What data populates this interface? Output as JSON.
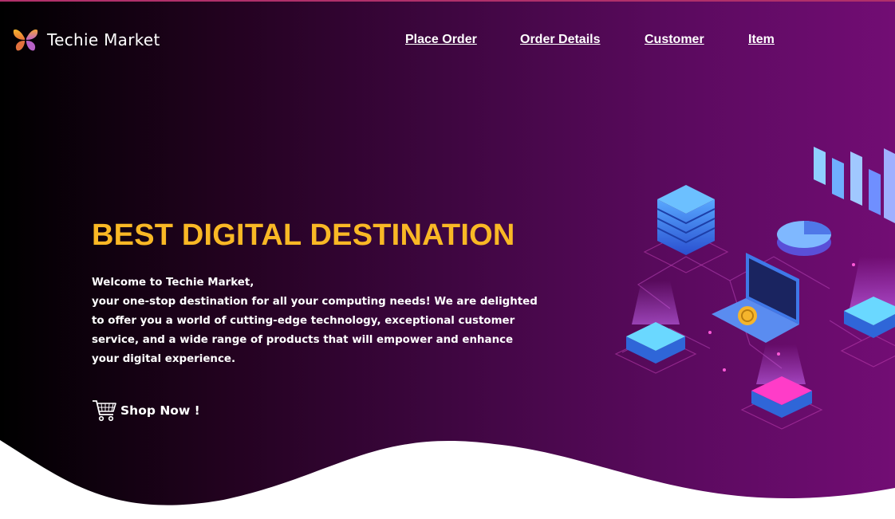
{
  "brand": {
    "name": "Techie Market"
  },
  "nav": {
    "items": [
      {
        "label": "Place Order"
      },
      {
        "label": "Order Details"
      },
      {
        "label": "Customer"
      },
      {
        "label": "Item"
      }
    ]
  },
  "hero": {
    "headline": "BEST DIGITAL DESTINATION",
    "greeting": "Welcome to Techie Market,",
    "description": "your one-stop destination for all your computing needs! We are delighted to offer you a world of cutting-edge technology, exceptional customer service, and a wide range of products that will empower and enhance your digital experience.",
    "cta_label": "Shop Now !"
  },
  "colors": {
    "headline": "#f9b825",
    "gradient_start": "#000000",
    "gradient_end": "#720d74",
    "nav_text": "#ffffff"
  },
  "icons": {
    "logo": "butterfly-logo-icon",
    "cta": "shopping-cart-icon"
  }
}
